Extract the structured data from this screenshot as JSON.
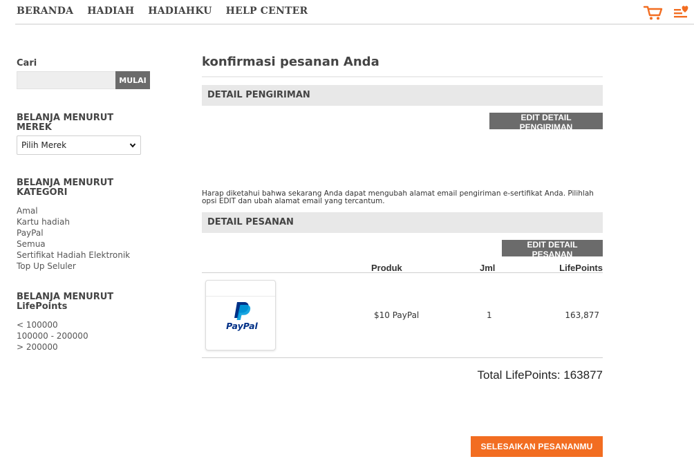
{
  "nav": {
    "items": [
      "BERANDA",
      "HADIAH",
      "HADIAHKU",
      "HELP CENTER"
    ],
    "icons": [
      "cart-icon",
      "wishlist-icon"
    ],
    "accent": "#f26d21"
  },
  "sidebar": {
    "search_label": "Cari",
    "search_placeholder": "",
    "search_button": "MULAI",
    "brand_heading": "BELANJA MENURUT MEREK",
    "brand_select": "Pilih Merek",
    "category_heading": "BELANJA MENURUT KATEGORI",
    "categories": [
      "Amal",
      "Kartu hadiah",
      "PayPal",
      "Semua",
      "Sertifikat Hadiah Elektronik",
      "Top Up Seluler"
    ],
    "points_heading": "BELANJA MENURUT LifePoints",
    "points_ranges": [
      "< 100000",
      "100000 - 200000",
      "> 200000"
    ]
  },
  "main": {
    "title": "konfirmasi pesanan Anda",
    "shipping_section": "DETAIL PENGIRIMAN",
    "edit_shipping_button": "EDIT DETAIL PENGIRIMAN",
    "notice": "Harap diketahui bahwa sekarang Anda dapat mengubah alamat email pengiriman e-sertifikat Anda. Pilihlah opsi EDIT dan ubah alamat email yang tercantum.",
    "order_section": "DETAIL PESANAN",
    "edit_order_button": "EDIT DETAIL PESANAN",
    "columns": {
      "product": "Produk",
      "qty": "Jml",
      "points": "LifePoints"
    },
    "items": [
      {
        "logo_text": "PayPal",
        "product": "$10 PayPal",
        "qty": "1",
        "points": "163,877"
      }
    ],
    "total": "Total LifePoints: 163877",
    "finish_button": "SELESAIKAN PESANANMU"
  }
}
